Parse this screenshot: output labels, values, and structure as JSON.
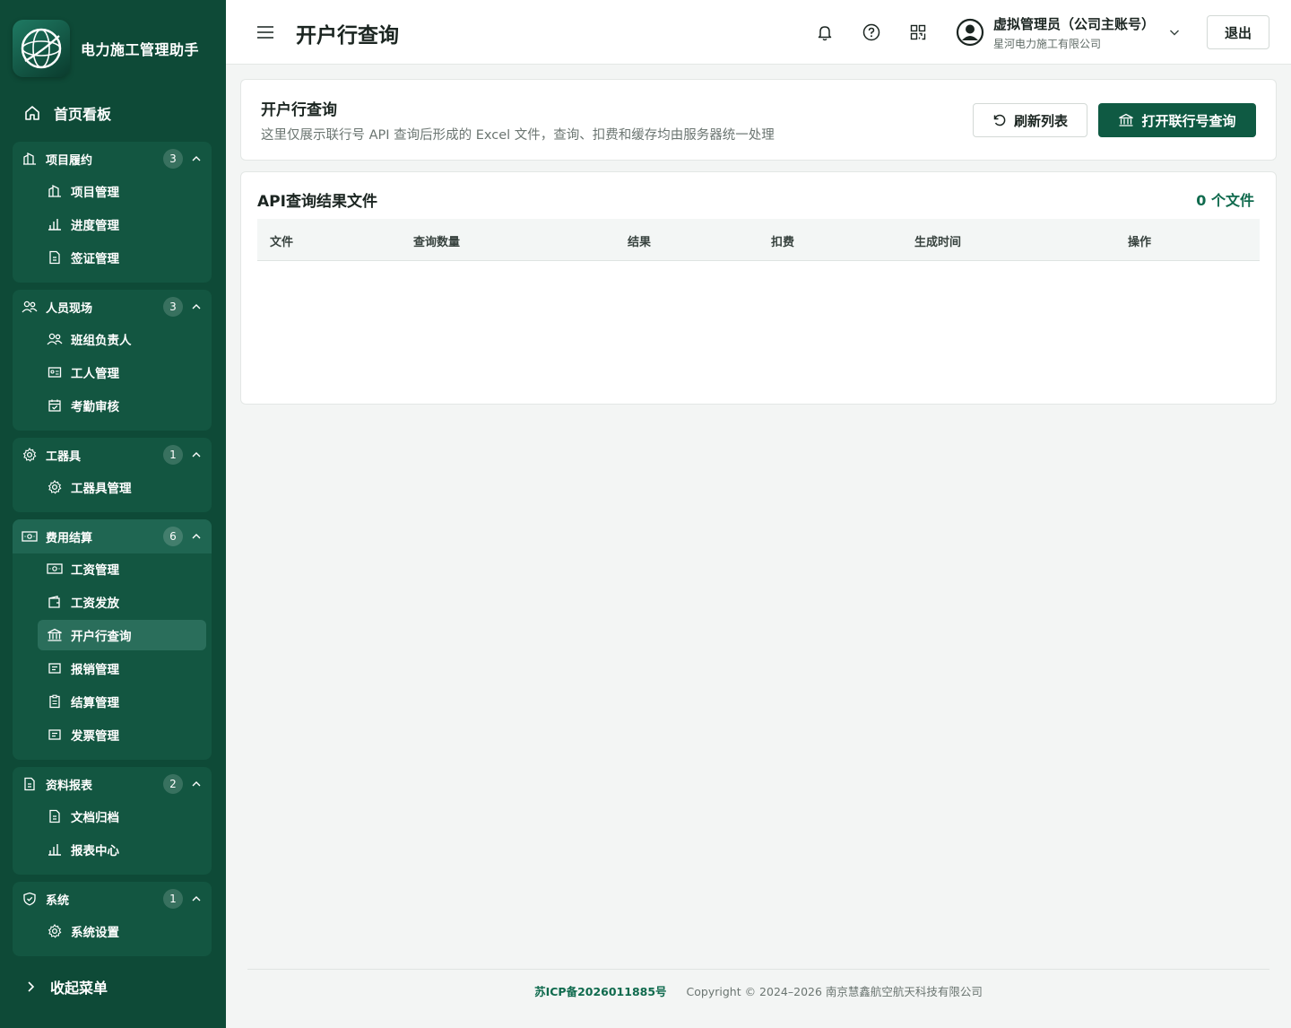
{
  "brand": {
    "name": "电力施工管理助手"
  },
  "nav": {
    "home": "首页看板",
    "collapse": "收起菜单",
    "groups": [
      {
        "label": "项目履约",
        "count": "3",
        "items": [
          "项目管理",
          "进度管理",
          "签证管理"
        ]
      },
      {
        "label": "人员现场",
        "count": "3",
        "items": [
          "班组负责人",
          "工人管理",
          "考勤审核"
        ]
      },
      {
        "label": "工器具",
        "count": "1",
        "items": [
          "工器具管理"
        ]
      },
      {
        "label": "费用结算",
        "count": "6",
        "items": [
          "工资管理",
          "工资发放",
          "开户行查询",
          "报销管理",
          "结算管理",
          "发票管理"
        ]
      },
      {
        "label": "资料报表",
        "count": "2",
        "items": [
          "文档归档",
          "报表中心"
        ]
      },
      {
        "label": "系统",
        "count": "1",
        "items": [
          "系统设置"
        ]
      }
    ],
    "active_item": "开户行查询"
  },
  "header": {
    "title": "开户行查询",
    "user_name": "虚拟管理员（公司主账号）",
    "company": "星河电力施工有限公司",
    "logout": "退出"
  },
  "intro": {
    "title": "开户行查询",
    "description": "这里仅展示联行号 API 查询后形成的 Excel 文件，查询、扣费和缓存均由服务器统一处理",
    "refresh_label": "刷新列表",
    "open_label": "打开联行号查询"
  },
  "results": {
    "title": "API查询结果文件",
    "count": "0 个文件",
    "columns": [
      "文件",
      "查询数量",
      "结果",
      "扣费",
      "生成时间",
      "操作"
    ],
    "rows": []
  },
  "footer": {
    "icp": "苏ICP备2026011885号",
    "copyright": "Copyright © 2024–2026 南京慧鑫航空航天科技有限公司"
  },
  "colors": {
    "sidebar": "#0e4a37",
    "primary": "#0f5a43",
    "accent_text": "#0f6a4d"
  }
}
